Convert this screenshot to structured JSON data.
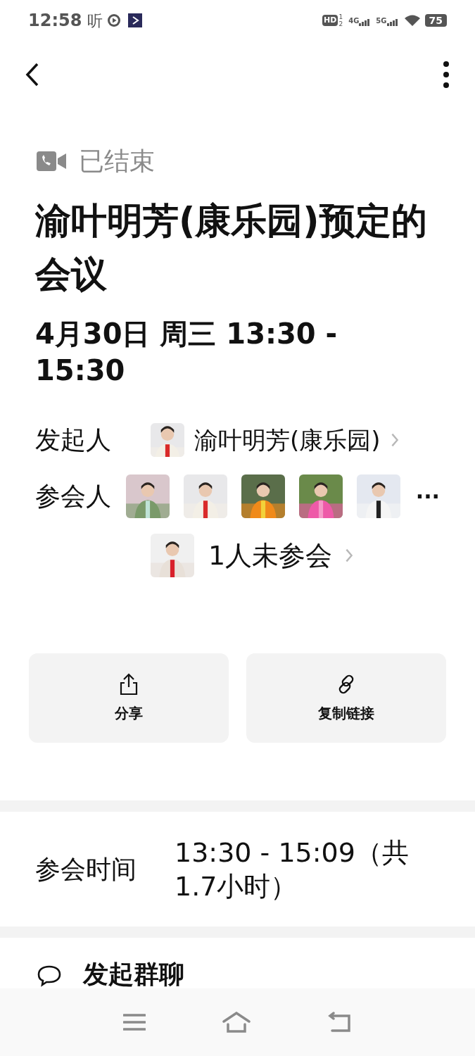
{
  "status_bar": {
    "time": "12:58",
    "listen_label": "听",
    "hd_label": "HD",
    "sim_labels": [
      "1",
      "2"
    ],
    "networks": [
      "4G",
      "5G"
    ],
    "battery": "75"
  },
  "meeting": {
    "status": "已结束",
    "title": "渝叶明芳(康乐园)预定的会议",
    "datetime": "4月30日 周三 13:30 - 15:30"
  },
  "initiator": {
    "label": "发起人",
    "name": "渝叶明芳(康乐园)"
  },
  "attendees": {
    "label": "参会人",
    "more": "···",
    "absent": "1人未参会"
  },
  "actions": [
    {
      "kind": "share",
      "label": "分享"
    },
    {
      "kind": "link",
      "label": "复制链接"
    }
  ],
  "attend_time": {
    "label": "参会时间",
    "value": "13:30 - 15:09（共1.7小时）"
  },
  "group_chat": {
    "label": "发起群聊"
  }
}
